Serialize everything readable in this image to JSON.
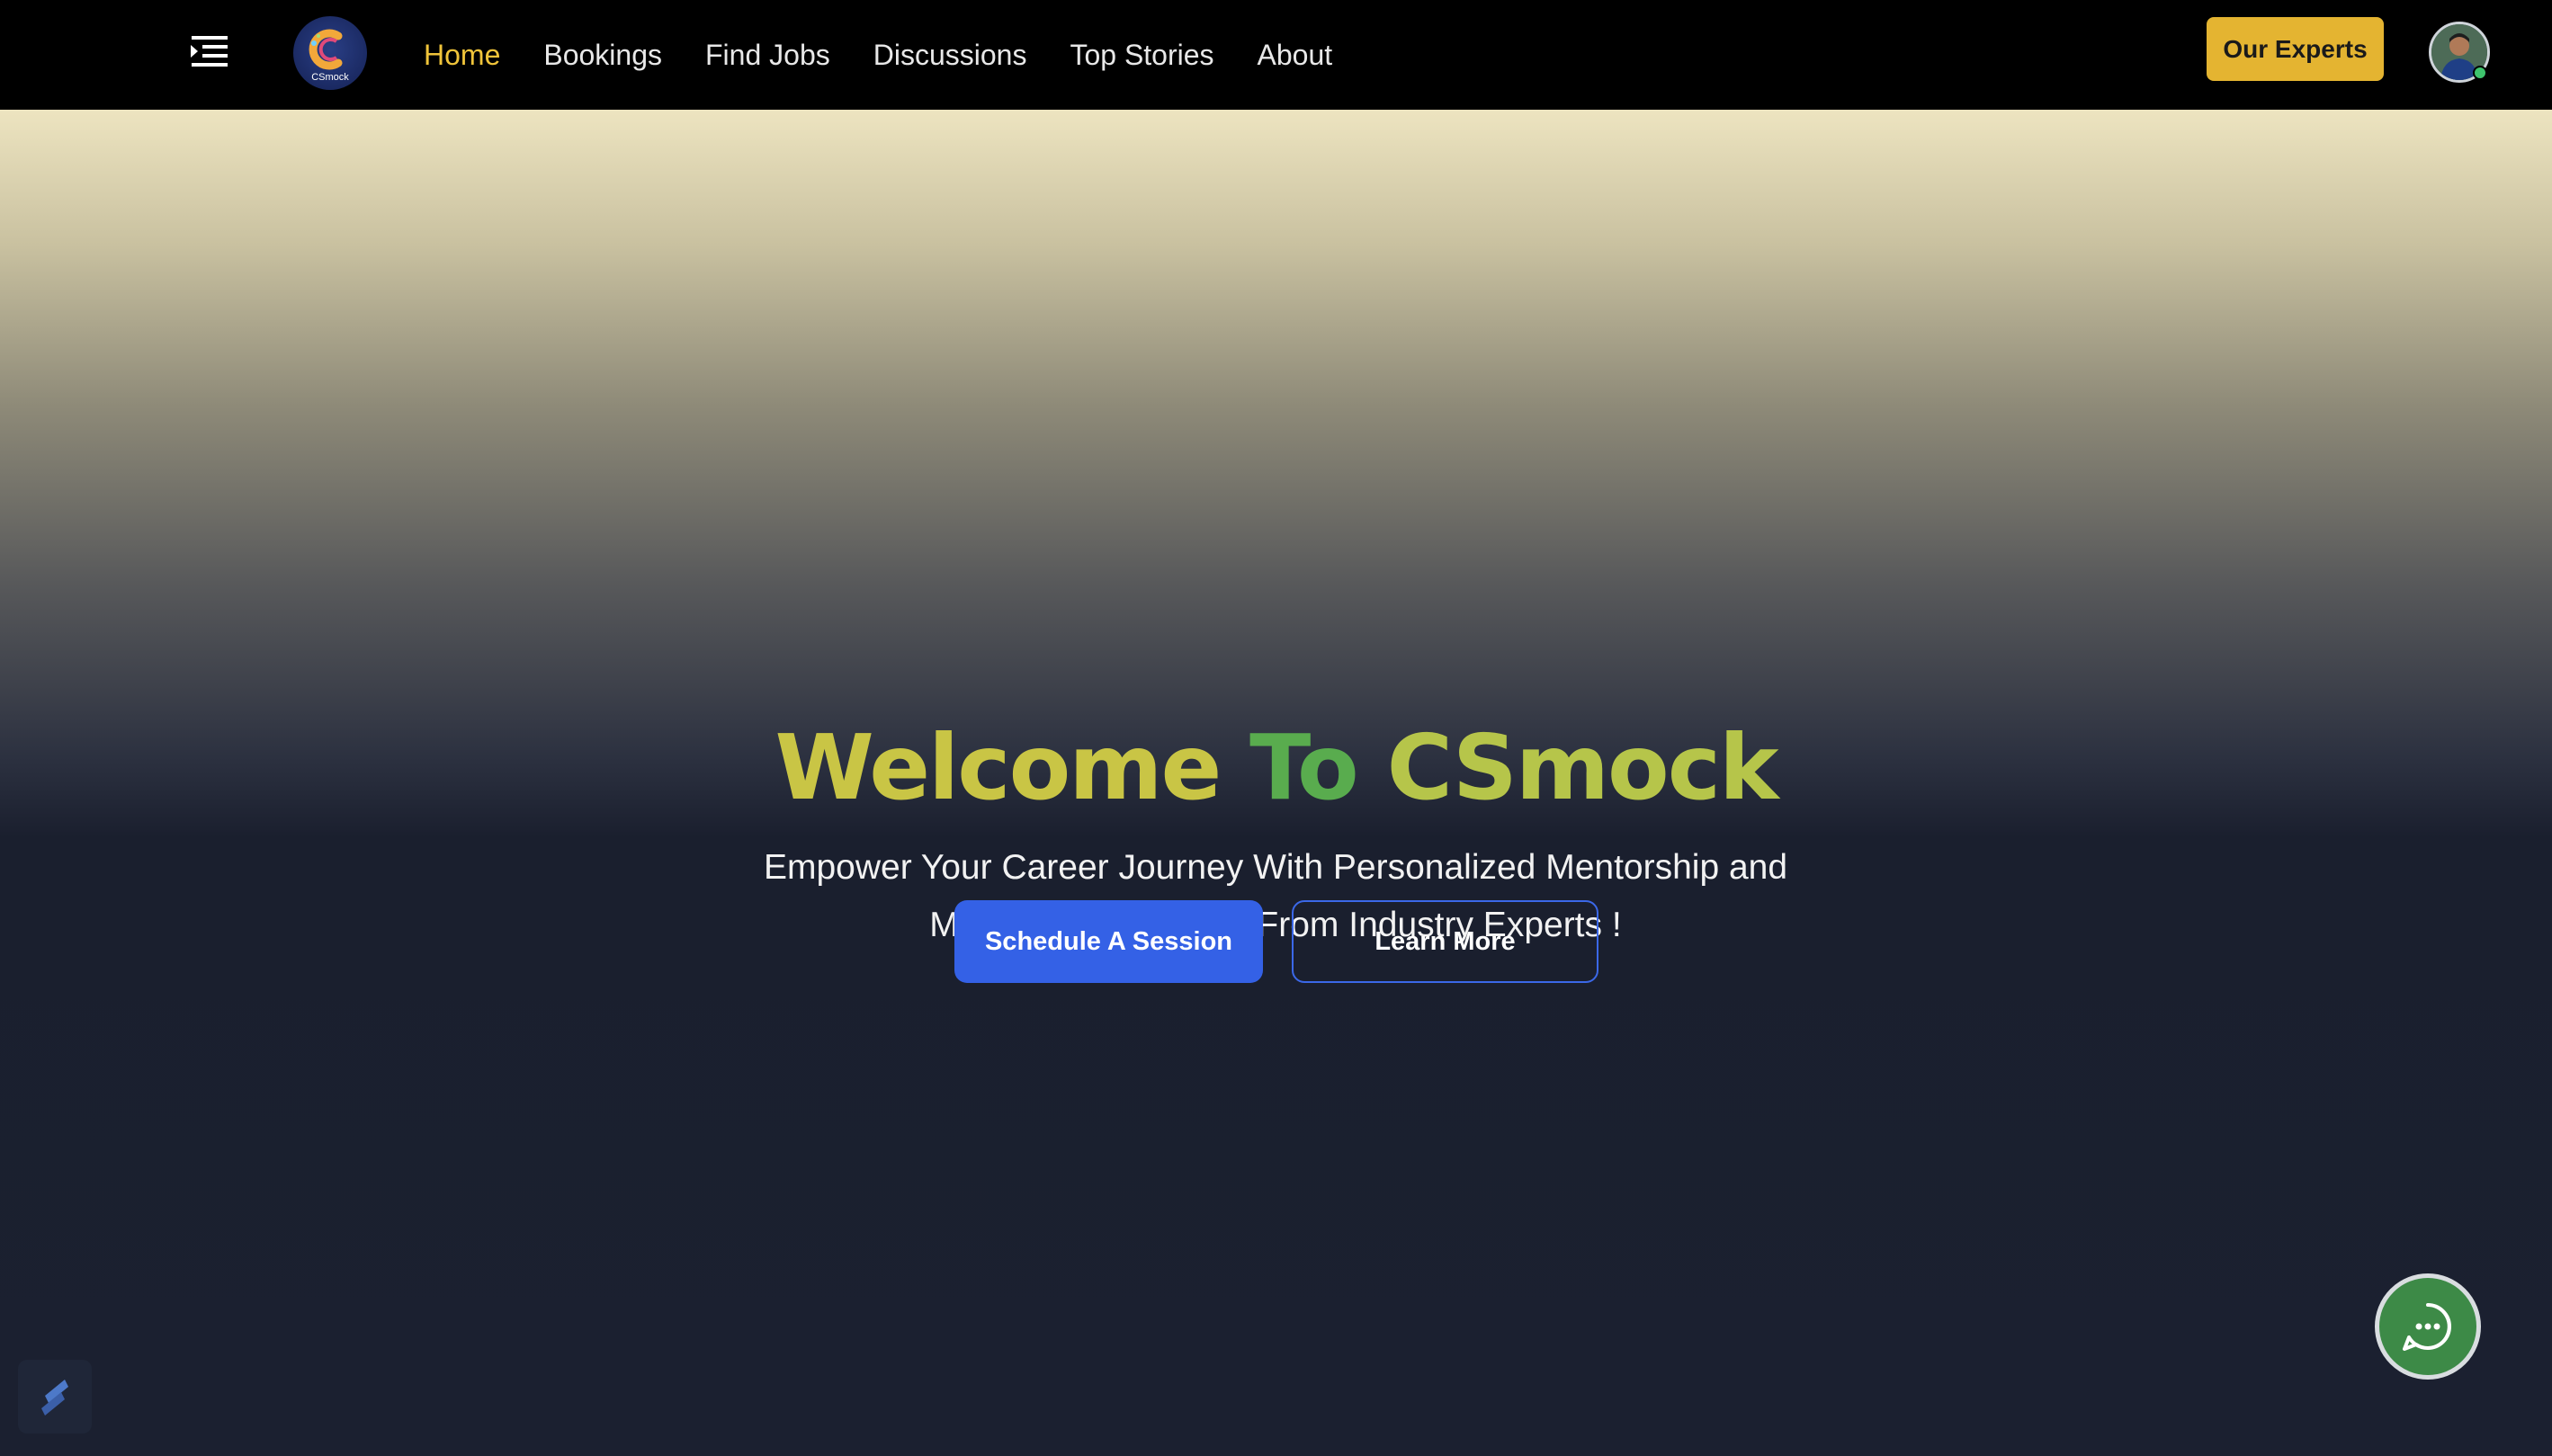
{
  "nav": {
    "menu_icon": "menu-indent-icon",
    "logo_text": "CSmock",
    "links": [
      {
        "label": "Home",
        "active": true
      },
      {
        "label": "Bookings",
        "active": false
      },
      {
        "label": "Find Jobs",
        "active": false
      },
      {
        "label": "Discussions",
        "active": false
      },
      {
        "label": "Top Stories",
        "active": false
      },
      {
        "label": "About",
        "active": false
      }
    ],
    "experts_button": "Our Experts",
    "avatar_status": "online"
  },
  "hero": {
    "title_part1": "Welcome",
    "title_part2": "To",
    "title_part3": "CSmock",
    "subtitle_line1": "Empower Your Career Journey With Personalized Mentorship and",
    "subtitle_line2": "Mock Job Interviews From Industry Experts !",
    "primary_button": "Schedule A Session",
    "secondary_button": "Learn More"
  },
  "widgets": {
    "chat_icon": "chat-bubble-icon",
    "corner_icon": "stackbit-icon"
  },
  "colors": {
    "nav_bg": "#000000",
    "accent_yellow": "#e4b431",
    "active_link": "#f0c43a",
    "primary_blue": "#3461e6",
    "chat_green": "#3d8a47",
    "title_yellow": "#c9c545",
    "title_green": "#59ac4e"
  }
}
